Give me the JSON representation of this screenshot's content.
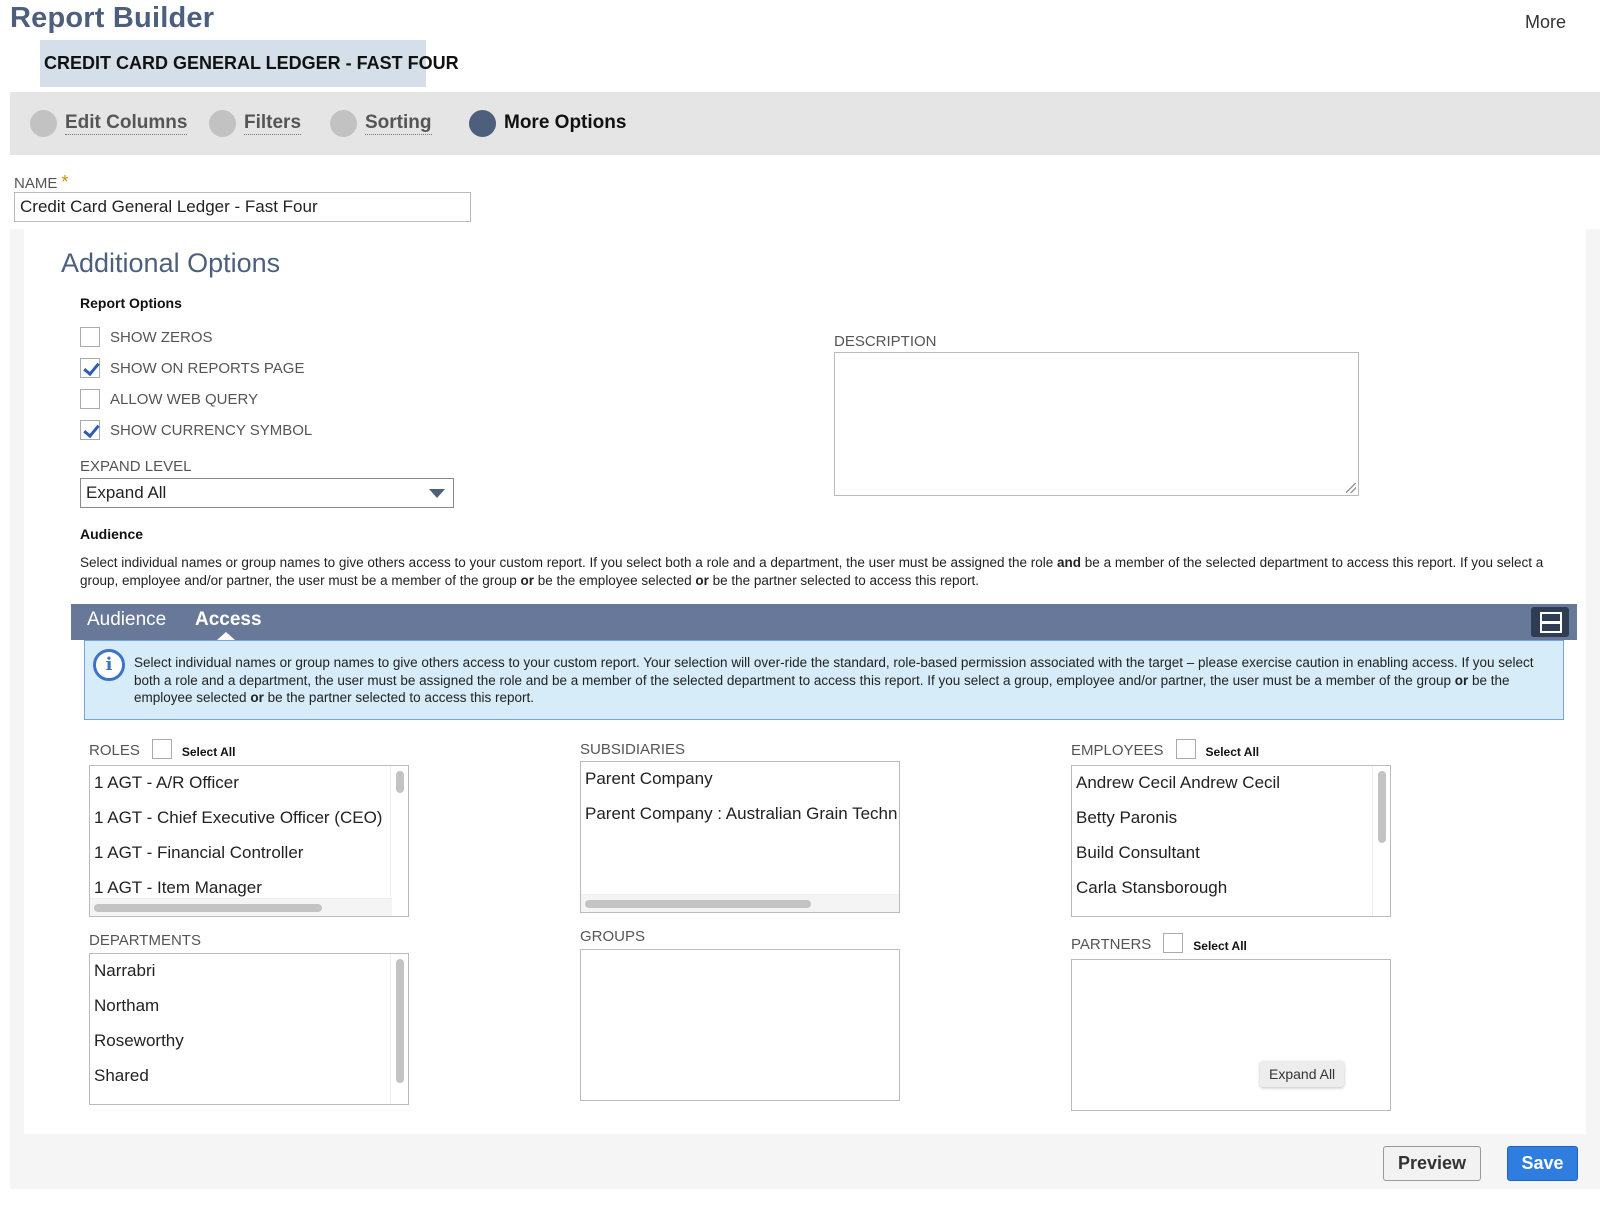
{
  "header": {
    "app_title": "Report Builder",
    "more_label": "More",
    "report_chip": "CREDIT CARD GENERAL LEDGER - FAST FOUR"
  },
  "steps": [
    {
      "label": "Edit Columns",
      "active": false
    },
    {
      "label": "Filters",
      "active": false
    },
    {
      "label": "Sorting",
      "active": false
    },
    {
      "label": "More Options",
      "active": true
    }
  ],
  "name_field": {
    "label": "NAME",
    "required_mark": "*",
    "value": "Credit Card General Ledger - Fast Four"
  },
  "additional_options": {
    "title": "Additional Options",
    "report_options_heading": "Report Options",
    "options": [
      {
        "label": "SHOW ZEROS",
        "checked": false
      },
      {
        "label": "SHOW ON REPORTS PAGE",
        "checked": true
      },
      {
        "label": "ALLOW WEB QUERY",
        "checked": false
      },
      {
        "label": "SHOW CURRENCY SYMBOL",
        "checked": true
      }
    ],
    "expand_level_label": "EXPAND LEVEL",
    "expand_level_value": "Expand All",
    "description_label": "DESCRIPTION",
    "description_value": ""
  },
  "audience": {
    "heading": "Audience",
    "para_1": "Select individual names or group names to give others access to your custom report. If you select both a role and a department, the user must be assigned the role ",
    "para_bold_1": "and",
    "para_2": " be a member of the selected department to access this report. If you select a group, employee and/or partner, the user must be a member of the group ",
    "para_bold_2": "or",
    "para_3": " be the employee selected ",
    "para_bold_3": "or",
    "para_4": " be the partner selected to access this report."
  },
  "tabs": [
    {
      "label": "Audience",
      "active": false
    },
    {
      "label": "Access",
      "active": true
    }
  ],
  "info": {
    "icon_glyph": "i",
    "text_1": "Select individual names or group names to give others access to your custom report. Your selection will over-ride the standard, role-based permission associated with the target – please exercise caution in enabling access. If you select both a role and a department, the user must be assigned the role and be a member of the selected department to access this report. If you select a group, employee and/or partner, the user must be a member of the group ",
    "bold_1": "or",
    "text_2": " be the employee selected ",
    "bold_2": "or",
    "text_3": " be the partner selected to access this report."
  },
  "lists": {
    "roles": {
      "label": "ROLES",
      "select_all": "Select All",
      "items": [
        "1 AGT - A/R Officer",
        "1 AGT - Chief Executive Officer (CEO)",
        "1 AGT - Financial Controller",
        "1 AGT - Item Manager"
      ]
    },
    "subsidiaries": {
      "label": "SUBSIDIARIES",
      "items": [
        "Parent Company",
        "Parent Company : Australian Grain Techn"
      ]
    },
    "employees": {
      "label": "EMPLOYEES",
      "select_all": "Select All",
      "items": [
        "Andrew Cecil Andrew Cecil",
        "Betty Paronis",
        "Build Consultant",
        "Carla Stansborough"
      ]
    },
    "departments": {
      "label": "DEPARTMENTS",
      "items": [
        "Narrabri",
        "Northam",
        "Roseworthy",
        "Shared"
      ]
    },
    "groups": {
      "label": "GROUPS",
      "items": []
    },
    "partners": {
      "label": "PARTNERS",
      "select_all": "Select All",
      "items": []
    }
  },
  "tooltip": "Expand All",
  "buttons": {
    "preview": "Preview",
    "save": "Save"
  },
  "colors": {
    "brand": "#4d5f7c",
    "tabbar": "#687898",
    "save": "#2f7dde",
    "info_bg": "#d6ecf8"
  }
}
